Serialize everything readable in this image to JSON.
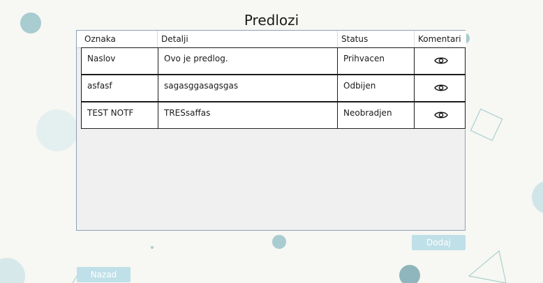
{
  "page": {
    "title": "Predlozi"
  },
  "table": {
    "columns": [
      "Oznaka",
      "Detalji",
      "Status",
      "Komentari"
    ],
    "rows": [
      {
        "oznaka": "Naslov",
        "detalji": "Ovo je predlog.",
        "status": "Prihvacen",
        "komentari_icon": "eye-icon"
      },
      {
        "oznaka": "asfasf",
        "detalji": "sagasggasagsgas",
        "status": "Odbijen",
        "komentari_icon": "eye-icon"
      },
      {
        "oznaka": "TEST NOTF",
        "detalji": "TRESsaffas",
        "status": "Neobradjen",
        "komentari_icon": "eye-icon"
      }
    ]
  },
  "buttons": {
    "add": "Dodaj",
    "back": "Nazad"
  },
  "colors": {
    "accent": "#bfe0e8",
    "decor": "#a9cfd3",
    "background": "#f7f7f3"
  }
}
